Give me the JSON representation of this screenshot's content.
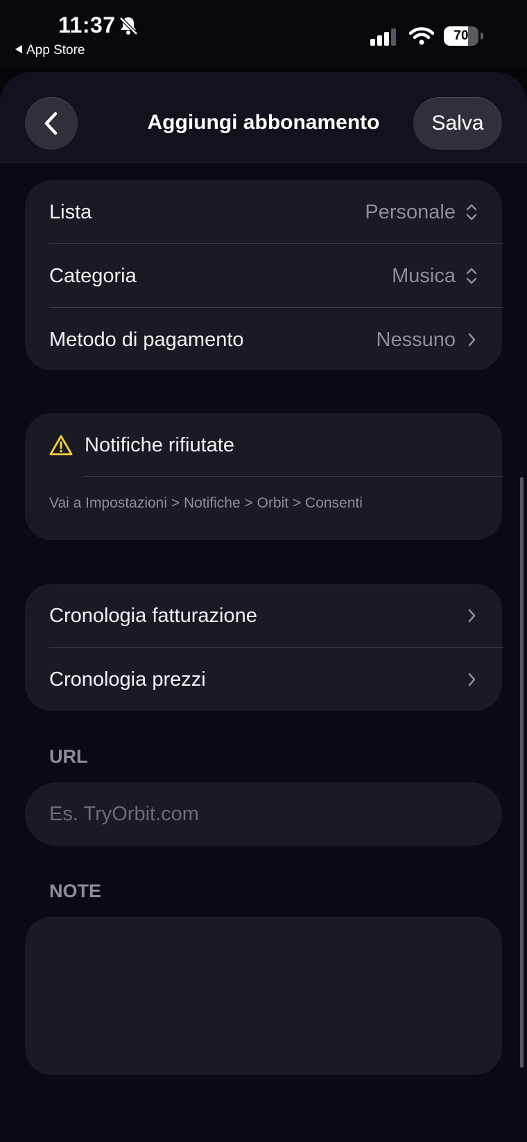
{
  "status_bar": {
    "time": "11:37",
    "back_app": "App Store",
    "battery_percent": "70",
    "battery_level": 0.7
  },
  "nav": {
    "title": "Aggiungi abbonamento",
    "save_label": "Salva"
  },
  "details": [
    {
      "label": "Lista",
      "value": "Personale",
      "accessory": "chevron-up-down-icon"
    },
    {
      "label": "Categoria",
      "value": "Musica",
      "accessory": "chevron-up-down-icon"
    },
    {
      "label": "Metodo di pagamento",
      "value": "Nessuno",
      "accessory": "chevron-right-icon"
    }
  ],
  "notifications": {
    "title": "Notifiche rifiutate",
    "hint": "Vai a Impostazioni > Notifiche > Orbit > Consenti",
    "icon": "warning-icon",
    "icon_color": "#f5d040"
  },
  "history": [
    {
      "label": "Cronologia fatturazione"
    },
    {
      "label": "Cronologia prezzi"
    }
  ],
  "url": {
    "label": "URL",
    "placeholder": "Es. TryOrbit.com"
  },
  "notes": {
    "label": "NOTE",
    "value": ""
  }
}
